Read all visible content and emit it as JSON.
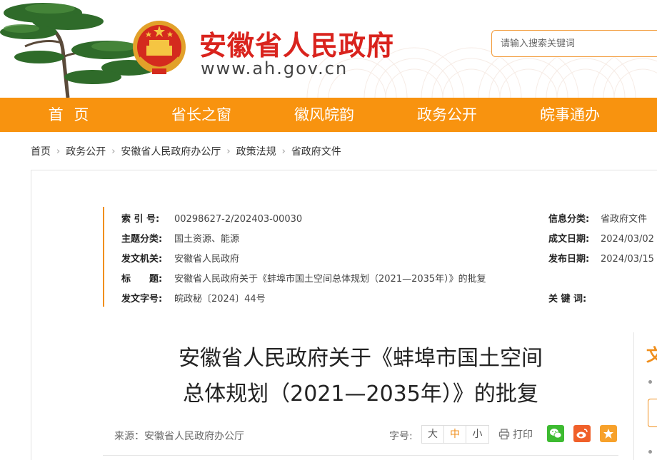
{
  "header": {
    "site_title": "安徽省人民政府",
    "site_url": "www.ah.gov.cn",
    "search_placeholder": "请输入搜索关键词"
  },
  "nav": {
    "items": [
      "首 页",
      "省长之窗",
      "徽风皖韵",
      "政务公开",
      "皖事通办"
    ]
  },
  "breadcrumb": {
    "items": [
      "首页",
      "政务公开",
      "安徽省人民政府办公厅",
      "政策法规",
      "省政府文件"
    ],
    "separator": "›"
  },
  "meta": {
    "index_label": "索 引 号:",
    "index_value": "00298627-2/202403-00030",
    "category_label": "主题分类:",
    "category_value": "国土资源、能源",
    "issuer_label": "发文机关:",
    "issuer_value": "安徽省人民政府",
    "title_label": "标　　题:",
    "title_value": "安徽省人民政府关于《蚌埠市国土空间总体规划（2021—2035年）》的批复",
    "docno_label": "发文字号:",
    "docno_value": "皖政秘〔2024〕44号",
    "info_class_label": "信息分类:",
    "info_class_value": "省政府文件",
    "created_label": "成文日期:",
    "created_value": "2024/03/02",
    "published_label": "发布日期:",
    "published_value": "2024/03/15",
    "keywords_label": "关 键 词:",
    "keywords_value": ""
  },
  "document": {
    "title_line1": "安徽省人民政府关于《蚌埠市国土空间",
    "title_line2": "总体规划（2021—2035年）》的批复",
    "source": "来源：安徽省人民政府办公厅",
    "fontsize_label": "字号:",
    "fontsize_options": [
      "大",
      "中",
      "小"
    ],
    "print_label": "打印"
  },
  "sidebar": {
    "heading_fragment": "文"
  },
  "colors": {
    "brand_red": "#d9231d",
    "nav_orange": "#f8930f",
    "accent_orange": "#f08f1d",
    "wechat_green": "#3dbb31",
    "weibo_red": "#f0602a",
    "fav_orange": "#f7a12b"
  },
  "icons": {
    "emblem": "national-emblem-icon",
    "print": "printer-icon",
    "wechat": "wechat-icon",
    "weibo": "weibo-icon",
    "favorite": "star-icon"
  }
}
